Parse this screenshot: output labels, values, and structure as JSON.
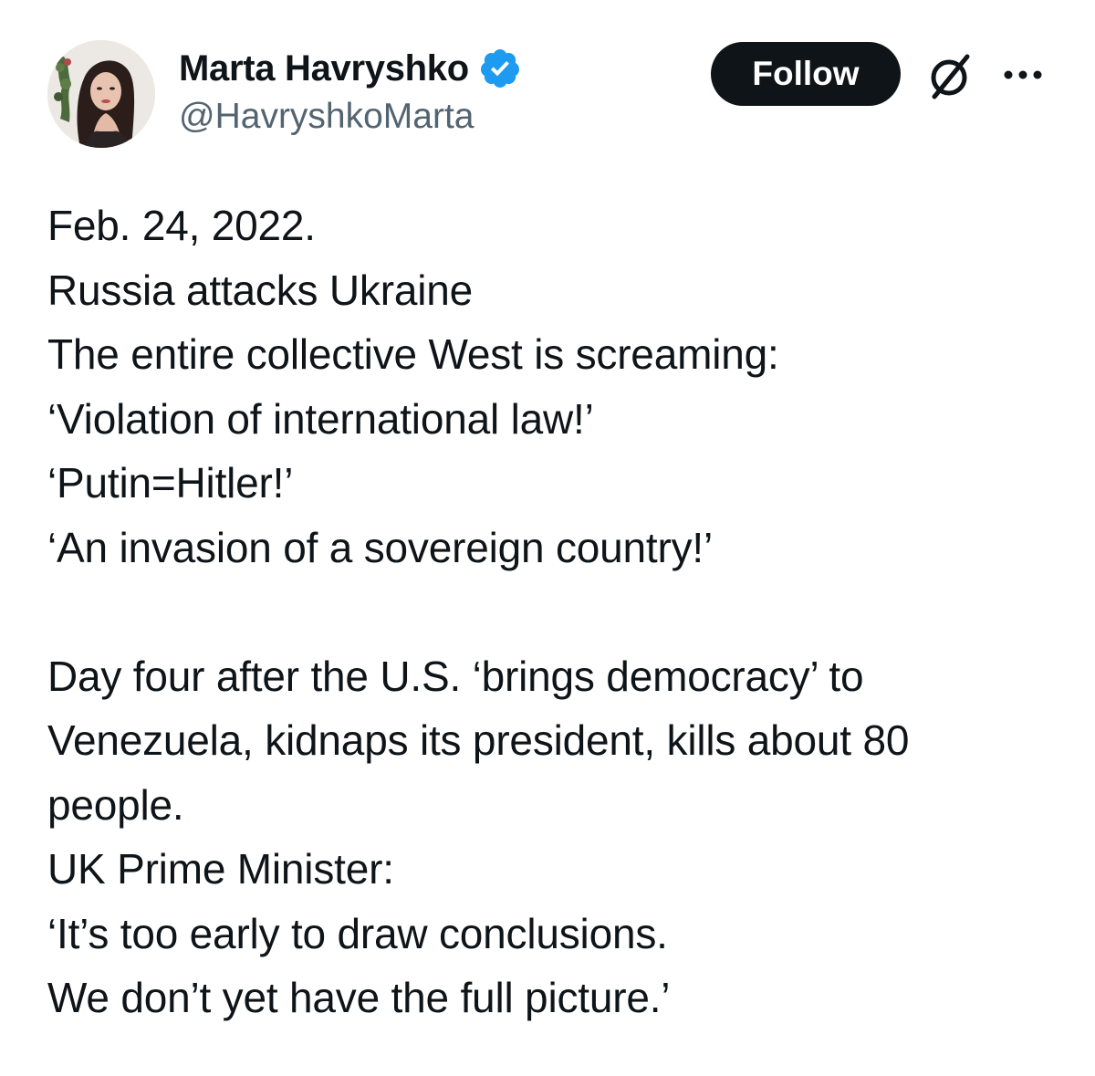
{
  "author": {
    "display_name": "Marta Havryshko",
    "handle": "@HavryshkoMarta",
    "verified": true,
    "avatar_icon": "profile-photo"
  },
  "actions": {
    "follow_label": "Follow",
    "grok_icon": "grok-slash-circle-icon",
    "more_icon": "more-dots-icon"
  },
  "colors": {
    "text": "#0f1419",
    "secondary_text": "#536471",
    "follow_bg": "#0f1419",
    "verified_badge": "#1d9bf0"
  },
  "post": {
    "paragraph_1": [
      "Feb. 24, 2022.",
      "Russia attacks Ukraine",
      "The entire collective West is screaming:",
      "‘Violation of international law!’",
      "‘Putin=Hitler!’",
      "‘An invasion of a sovereign country!’"
    ],
    "paragraph_2": [
      "Day four after the U.S. ‘brings democracy’ to",
      "Venezuela, kidnaps its president, kills about 80",
      "people.",
      "UK Prime Minister:",
      "‘It’s too early to draw conclusions.",
      "We don’t yet have the full picture.’"
    ]
  }
}
